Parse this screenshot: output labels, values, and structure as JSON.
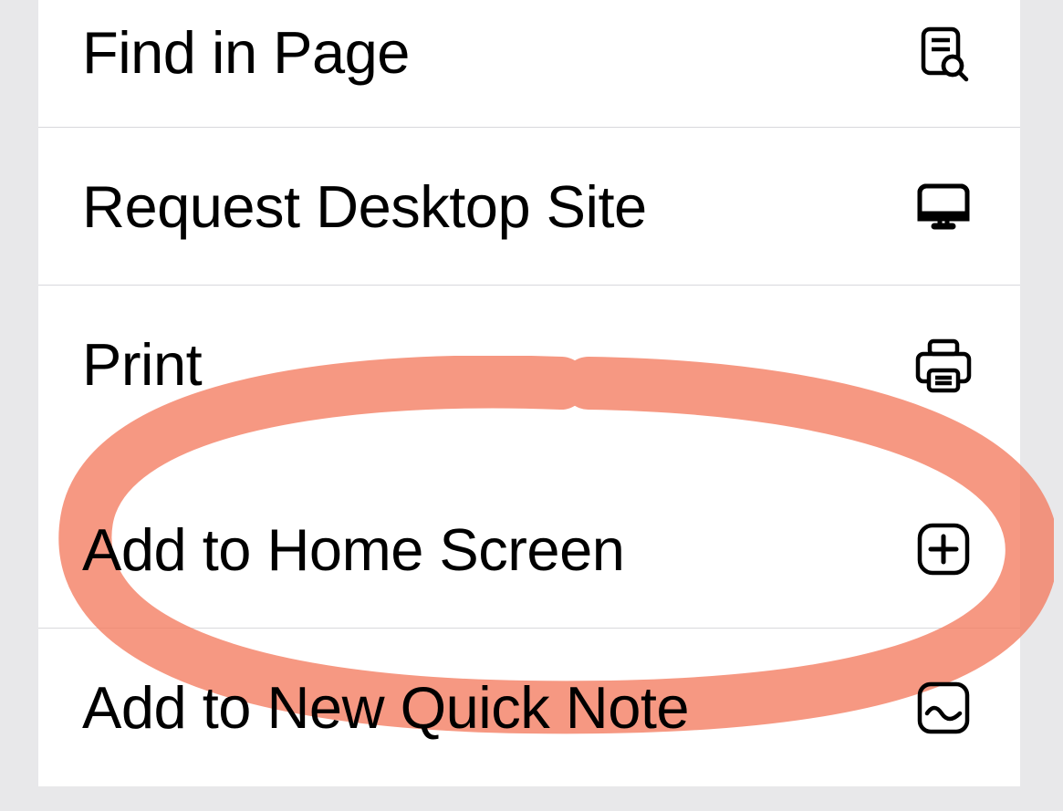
{
  "menu": {
    "section1": [
      {
        "label": "Find in Page",
        "icon": "find-in-page-icon"
      },
      {
        "label": "Request Desktop Site",
        "icon": "desktop-icon"
      },
      {
        "label": "Print",
        "icon": "printer-icon"
      }
    ],
    "section2": [
      {
        "label": "Add to Home Screen",
        "icon": "add-square-icon"
      },
      {
        "label": "Add to New Quick Note",
        "icon": "quick-note-icon"
      }
    ]
  },
  "annotation": {
    "color": "#f47b5f",
    "highlighted_item": "Add to Home Screen"
  }
}
